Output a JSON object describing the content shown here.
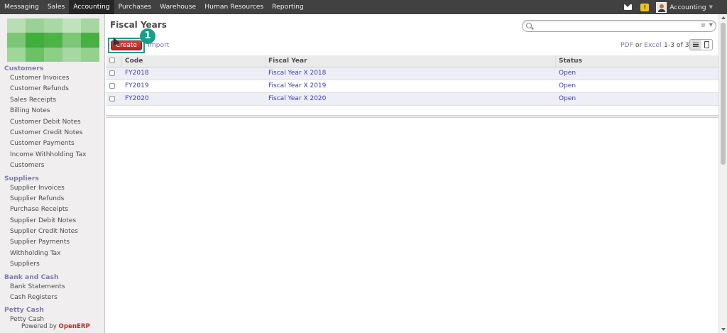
{
  "topbar": {
    "menu": [
      "Messaging",
      "Sales",
      "Accounting",
      "Purchases",
      "Warehouse",
      "Human Resources",
      "Reporting"
    ],
    "active": "Accounting",
    "user": "Accounting"
  },
  "sidebar": {
    "sections": [
      {
        "title": "Customers",
        "items": [
          "Customer Invoices",
          "Customer Refunds",
          "Sales Receipts",
          "Billing Notes",
          "Customer Debit Notes",
          "Customer Credit Notes",
          "Customer Payments",
          "Income Withholding Tax",
          "Customers"
        ]
      },
      {
        "title": "Suppliers",
        "items": [
          "Supplier Invoices",
          "Supplier Refunds",
          "Purchase Receipts",
          "Supplier Debit Notes",
          "Supplier Credit Notes",
          "Supplier Payments",
          "Withholding Tax",
          "Suppliers"
        ]
      },
      {
        "title": "Bank and Cash",
        "items": [
          "Bank Statements",
          "Cash Registers"
        ]
      },
      {
        "title": "Petty Cash",
        "items": [
          "Petty Cash"
        ]
      }
    ],
    "powered_by": "Powered by",
    "powered_brand": "OpenERP"
  },
  "main": {
    "title": "Fiscal Years",
    "search_placeholder": "",
    "create_label": "Create",
    "step_badge": "1",
    "import_label": "Import",
    "export_pdf": "PDF",
    "export_or": "or",
    "export_excel": "Excel",
    "pager": "1-3 of 3",
    "columns": [
      "Code",
      "Fiscal Year",
      "Status"
    ],
    "rows": [
      {
        "code": "FY2018",
        "name": "Fiscal Year X 2018",
        "status": "Open"
      },
      {
        "code": "FY2019",
        "name": "Fiscal Year X 2019",
        "status": "Open"
      },
      {
        "code": "FY2020",
        "name": "Fiscal Year X 2020",
        "status": "Open"
      }
    ]
  },
  "colors": {
    "topbar": "#414141",
    "accent_red": "#b92c28",
    "link": "#7c7bad",
    "highlight_teal": "#1a9e8c"
  }
}
